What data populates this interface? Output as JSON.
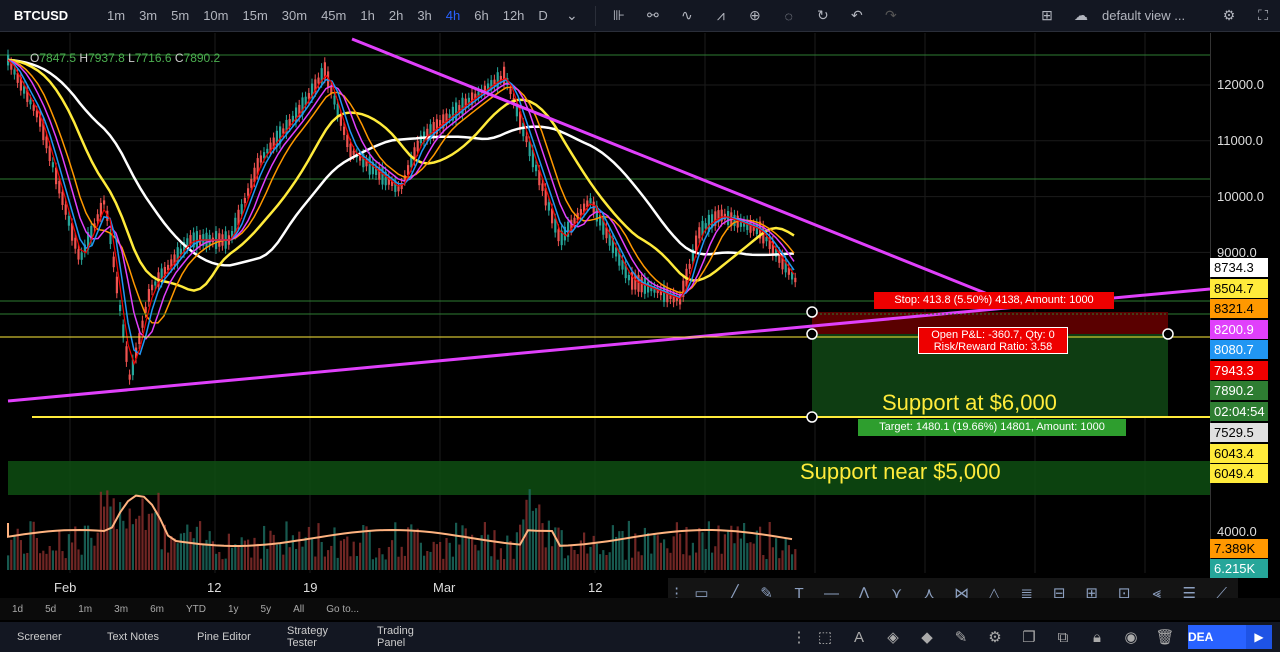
{
  "toolbar": {
    "symbol": "BTCUSD",
    "timeframes": [
      "1m",
      "3m",
      "5m",
      "10m",
      "15m",
      "30m",
      "45m",
      "1h",
      "2h",
      "3h",
      "4h",
      "6h",
      "12h",
      "D"
    ],
    "active_timeframe": "4h",
    "layout_name": "default view ..."
  },
  "ohlc": {
    "o_label": "O",
    "o": "7847.5",
    "h_label": "H",
    "h": "7937.8",
    "l_label": "L",
    "l": "7716.6",
    "c_label": "C",
    "c": "7890.2"
  },
  "price_axis": {
    "ticks": [
      "12000.0",
      "11000.0",
      "10000.0",
      "9000.0",
      "4000.0"
    ],
    "labels": [
      {
        "text": "8734.3",
        "bg": "#ffffff"
      },
      {
        "text": "8504.7",
        "bg": "#ffeb3b"
      },
      {
        "text": "8321.4",
        "bg": "#ff9800"
      },
      {
        "text": "8200.9",
        "bg": "#e040fb"
      },
      {
        "text": "8080.7",
        "bg": "#2196f3"
      },
      {
        "text": "7943.3",
        "bg": "#f00000"
      },
      {
        "text": "7890.2",
        "bg": "#2e7d32"
      },
      {
        "text": "02:04:54",
        "bg": "#2e7d32"
      },
      {
        "text": "7529.5",
        "bg": "#e0e0e0"
      },
      {
        "text": "6043.4",
        "bg": "#ffeb3b"
      },
      {
        "text": "6049.4",
        "bg": "#ffeb3b"
      },
      {
        "text": "7.389K",
        "bg": "#ff9800"
      },
      {
        "text": "6.215K",
        "bg": "#26a69a"
      }
    ]
  },
  "time_axis": [
    "Feb",
    "12",
    "19",
    "Mar",
    "12"
  ],
  "range_bar": [
    "1d",
    "5d",
    "1m",
    "3m",
    "6m",
    "YTD",
    "1y",
    "5y",
    "All",
    "Go to..."
  ],
  "annotations": {
    "stop": "Stop: 413.8 (5.50%) 4138, Amount: 1000",
    "pnl_line1": "Open P&L: -360.7, Qty: 0",
    "pnl_line2": "Risk/Reward Ratio: 3.58",
    "target": "Target: 1480.1 (19.66%) 14801, Amount: 1000",
    "support_6000": "Support at $6,000",
    "support_5000": "Support near $5,000"
  },
  "bottom_tabs": [
    "Screener",
    "Text Notes",
    "Pine Editor",
    "Strategy Tester",
    "Trading Panel"
  ],
  "publish_label": "DEA",
  "colors": {
    "accent": "#2962ff",
    "trendline": "#e040fb",
    "support": "#ffeb3b",
    "stop_zone": "#e00000",
    "target_zone": "#2e9e2e"
  }
}
